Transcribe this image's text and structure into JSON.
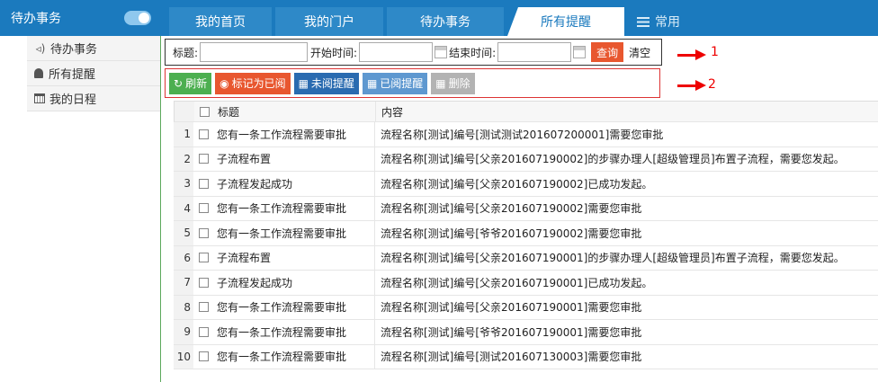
{
  "sidebar": {
    "header": "待办事务",
    "items": [
      {
        "label": "待办事务",
        "icon": "speaker-icon"
      },
      {
        "label": "所有提醒",
        "icon": "bell-icon"
      },
      {
        "label": "我的日程",
        "icon": "calendar-icon"
      }
    ]
  },
  "tabs": [
    {
      "label": "我的首页"
    },
    {
      "label": "我的门户"
    },
    {
      "label": "待办事务"
    },
    {
      "label": "所有提醒",
      "active": true
    },
    {
      "label": "常用",
      "icon": "menu-icon"
    }
  ],
  "search": {
    "title_label": "标题:",
    "title_value": "",
    "start_label": "开始时间:",
    "start_value": "",
    "end_label": "结束时间:",
    "end_value": "",
    "query_label": "查询",
    "clear_label": "清空"
  },
  "toolbar": {
    "refresh": "刷新",
    "mark_read": "标记为已阅",
    "unread": "未阅提醒",
    "read": "已阅提醒",
    "delete": "删除"
  },
  "annotations": {
    "a1": "1",
    "a2": "2"
  },
  "table": {
    "columns": {
      "title": "标题",
      "content": "内容"
    },
    "rows": [
      {
        "num": "1",
        "title": "您有一条工作流程需要审批",
        "content": "流程名称[测试]编号[测试测试201607200001]需要您审批"
      },
      {
        "num": "2",
        "title": "子流程布置",
        "content": "流程名称[测试]编号[父亲201607190002]的步骤办理人[超级管理员]布置子流程，需要您发起。"
      },
      {
        "num": "3",
        "title": "子流程发起成功",
        "content": "流程名称[测试]编号[父亲201607190002]已成功发起。"
      },
      {
        "num": "4",
        "title": "您有一条工作流程需要审批",
        "content": "流程名称[测试]编号[父亲201607190002]需要您审批"
      },
      {
        "num": "5",
        "title": "您有一条工作流程需要审批",
        "content": "流程名称[测试]编号[爷爷201607190002]需要您审批"
      },
      {
        "num": "6",
        "title": "子流程布置",
        "content": "流程名称[测试]编号[父亲201607190001]的步骤办理人[超级管理员]布置子流程，需要您发起。"
      },
      {
        "num": "7",
        "title": "子流程发起成功",
        "content": "流程名称[测试]编号[父亲201607190001]已成功发起。"
      },
      {
        "num": "8",
        "title": "您有一条工作流程需要审批",
        "content": "流程名称[测试]编号[父亲201607190001]需要您审批"
      },
      {
        "num": "9",
        "title": "您有一条工作流程需要审批",
        "content": "流程名称[测试]编号[爷爷201607190001]需要您审批"
      },
      {
        "num": "10",
        "title": "您有一条工作流程需要审批",
        "content": "流程名称[测试]编号[测试201607130003]需要您审批"
      }
    ]
  }
}
